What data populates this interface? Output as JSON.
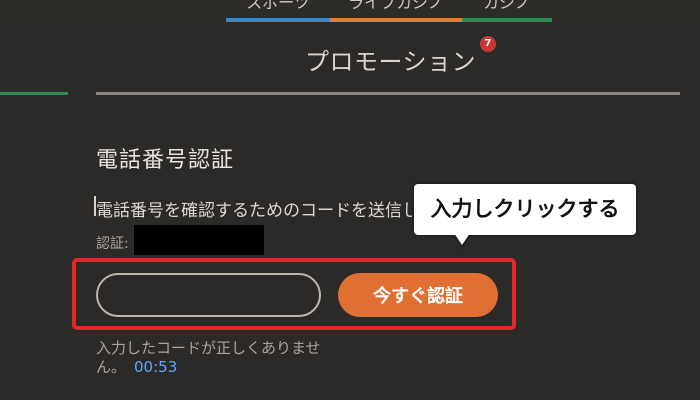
{
  "top_nav": {
    "tabs": [
      {
        "label": "スポーツ",
        "color": "#3d88c7"
      },
      {
        "label": "ライブカジノ",
        "color": "#de7b34"
      },
      {
        "label": "カジノ",
        "color": "#2f8a54"
      }
    ]
  },
  "header": {
    "title": "プロモーション",
    "badge_count": "7",
    "badge_color": "#c43a32"
  },
  "section": {
    "title": "電話番号認証",
    "description": "電話番号を確認するためのコードを送信し",
    "auth_label": "認証:"
  },
  "form": {
    "code_input_value": "",
    "verify_button": "今すぐ認証"
  },
  "annotation": {
    "tooltip": "入力しクリックする",
    "highlight_color": "#e32626"
  },
  "message": {
    "error": "入力したコードが正しくありません。",
    "timer": "00:53"
  }
}
